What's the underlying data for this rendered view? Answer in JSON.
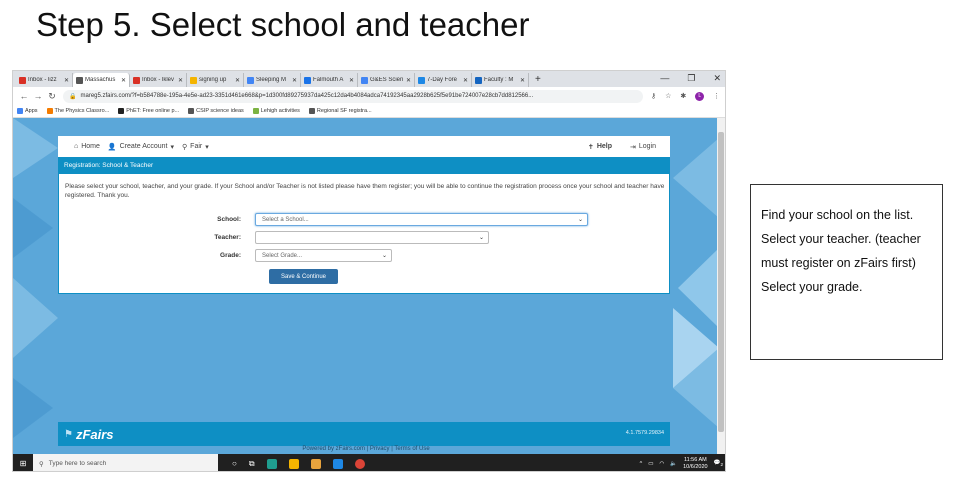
{
  "slide": {
    "title": "Step 5. Select school and teacher",
    "callout": "Find your school on the list. Select your teacher. (teacher must register on zFairs first) Select your grade."
  },
  "browser": {
    "tabs": [
      {
        "label": "Inbox - lizz",
        "favicon": "gmail-icon",
        "active": false
      },
      {
        "label": "Massachus",
        "favicon": "globe-icon",
        "active": true
      },
      {
        "label": "Inbox - lklev",
        "favicon": "gmail-icon",
        "active": false
      },
      {
        "label": "signing up",
        "favicon": "slides-icon",
        "active": false
      },
      {
        "label": "Sleeping M",
        "favicon": "docs-icon",
        "active": false
      },
      {
        "label": "Falmouth A",
        "favicon": "site-icon",
        "active": false
      },
      {
        "label": "G&ES Scien",
        "favicon": "docs-icon",
        "active": false
      },
      {
        "label": "7-Day Fore",
        "favicon": "weather-icon",
        "active": false
      },
      {
        "label": "Faculty : M",
        "favicon": "faculty-icon",
        "active": false
      }
    ],
    "new_tab": "+",
    "url": "mareg5.zfairs.com/?f=b584788e-195a-4e5e-ad23-3351d461e668&p=1d300fd89275937da425c12da4b4084adca74192345aa2928b625f5e91be724007e28cb7dd812566...",
    "bookmarks": [
      {
        "label": "Apps",
        "color": "#4285f4"
      },
      {
        "label": "The Physics Classro...",
        "color": "#f57c00"
      },
      {
        "label": "PhET: Free online p...",
        "color": "#222222"
      },
      {
        "label": "CSIP science ideas",
        "color": "#555555"
      },
      {
        "label": "Lehigh activities",
        "color": "#7cb342"
      },
      {
        "label": "Regional SF registra...",
        "color": "#555555"
      }
    ],
    "avatar_letter": "L"
  },
  "site": {
    "nav": {
      "home": "Home",
      "create_account": "Create Account",
      "fair": "Fair",
      "help": "Help",
      "login": "Login"
    },
    "section_title": "Registration: School & Teacher",
    "instructions": "Please select your school, teacher, and your grade. If your School and/or Teacher is not listed please have them register; you will be able to continue the registration process once your school and teacher have registered. Thank you.",
    "form": {
      "school_label": "School:",
      "school_value": "Select a School...",
      "teacher_label": "Teacher:",
      "teacher_value": "",
      "grade_label": "Grade:",
      "grade_value": "Select Grade...",
      "save_button": "Save & Continue"
    },
    "footer": {
      "logo": "zFairs",
      "version": "4.1.7579.29834",
      "powered": "Powered by zFairs.com | Privacy | Terms of Use"
    }
  },
  "taskbar": {
    "search_placeholder": "Type here to search",
    "time": "11:56 AM",
    "date": "10/6/2020",
    "notification_count": "2"
  },
  "colors": {
    "site_blue": "#0e8fc4",
    "page_bg": "#5ba7d9",
    "button_blue": "#2e6da4"
  }
}
